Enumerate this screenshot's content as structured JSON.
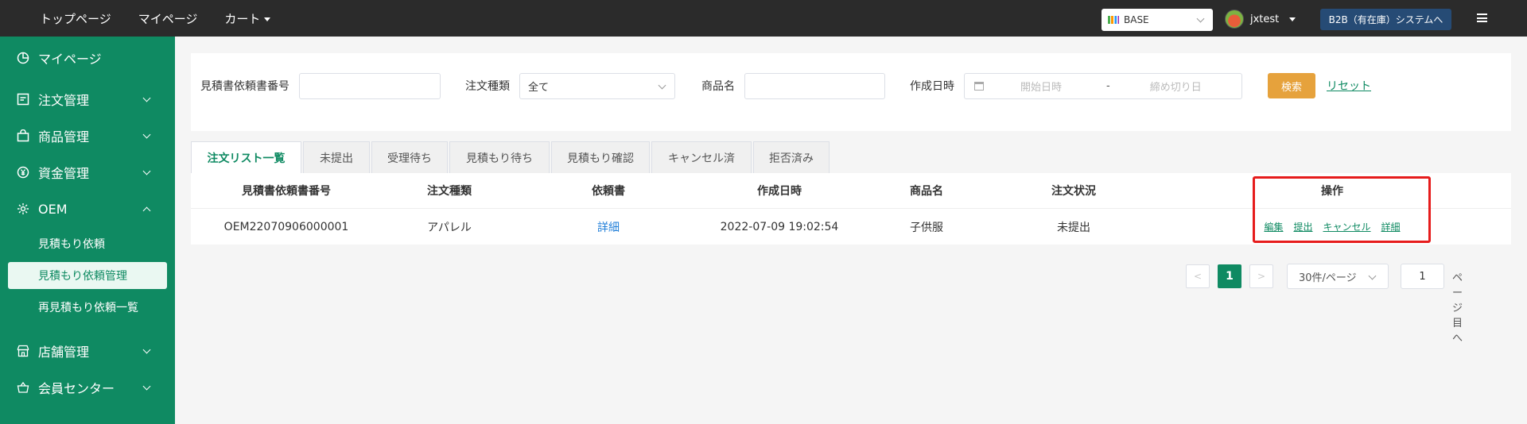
{
  "topnav": {
    "items": [
      "トップページ",
      "マイページ",
      "カート"
    ],
    "store_select": "BASE",
    "username": "jxtest",
    "b2b_button": "B2B（有在庫）システムへ"
  },
  "sidebar": {
    "mypage": "マイページ",
    "order_mgmt": "注文管理",
    "product_mgmt": "商品管理",
    "funds_mgmt": "資金管理",
    "oem": "OEM",
    "oem_sub": [
      "見積もり依頼",
      "見積もり依頼管理",
      "再見積もり依頼一覧"
    ],
    "store_mgmt": "店舗管理",
    "member_center": "会員センター"
  },
  "filters": {
    "quote_no_label": "見積書依頼書番号",
    "order_type_label": "注文種類",
    "order_type_value": "全て",
    "product_label": "商品名",
    "created_label": "作成日時",
    "start_placeholder": "開始日時",
    "range_sep": "-",
    "end_placeholder": "締め切り日",
    "search_button": "検索",
    "reset_link": "リセット"
  },
  "tabs": [
    "注文リスト一覧",
    "未提出",
    "受理待ち",
    "見積もり待ち",
    "見積もり確認",
    "キャンセル済",
    "拒否済み"
  ],
  "table": {
    "headers": [
      "見積書依頼書番号",
      "注文種類",
      "依頼書",
      "作成日時",
      "商品名",
      "注文状況",
      "操作"
    ],
    "rows": [
      {
        "quote_no": "OEM22070906000001",
        "order_type": "アパレル",
        "request": "詳細",
        "created": "2022-07-09 19:02:54",
        "product": "子供服",
        "status": "未提出",
        "actions": [
          "編集",
          "提出",
          "キャンセル",
          "詳細"
        ]
      }
    ]
  },
  "pagination": {
    "prev": "<",
    "current": "1",
    "next": ">",
    "page_size": "30件/ページ",
    "jump_value": "1",
    "jump_suffix": "ページ目へ"
  },
  "colors": {
    "brand_green": "#0f8a62",
    "search_orange": "#e6a23c",
    "highlight_red": "#e61c1c"
  }
}
